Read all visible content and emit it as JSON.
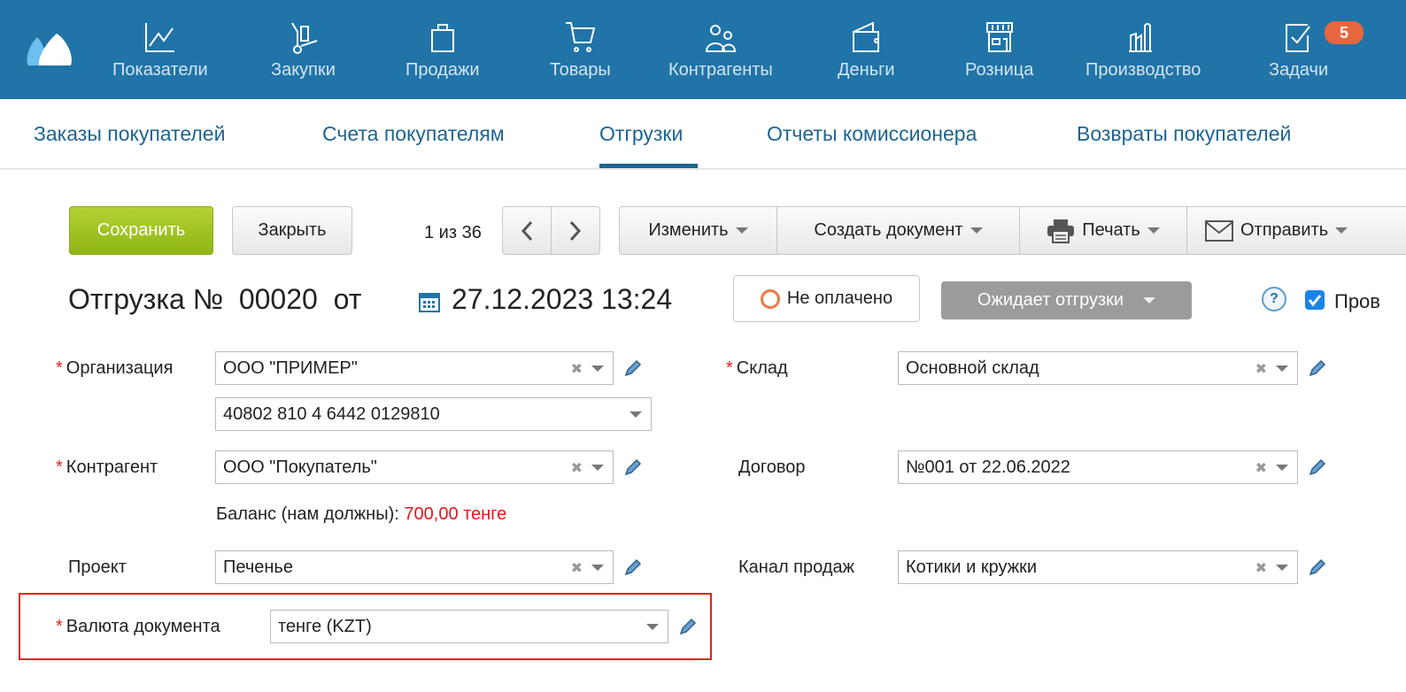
{
  "topnav": {
    "items": [
      {
        "label": "Показатели",
        "icon": "chart-line-icon"
      },
      {
        "label": "Закупки",
        "icon": "hand-truck-icon"
      },
      {
        "label": "Продажи",
        "icon": "shopping-bag-icon"
      },
      {
        "label": "Товары",
        "icon": "cart-icon"
      },
      {
        "label": "Контрагенты",
        "icon": "people-icon"
      },
      {
        "label": "Деньги",
        "icon": "wallet-icon"
      },
      {
        "label": "Розница",
        "icon": "store-icon"
      },
      {
        "label": "Производство",
        "icon": "factory-icon"
      },
      {
        "label": "Задачи",
        "icon": "task-check-icon",
        "badge": "5"
      }
    ],
    "color": "#2074a8"
  },
  "subnav": {
    "tabs": [
      {
        "label": "Заказы покупателей"
      },
      {
        "label": "Счета покупателям"
      },
      {
        "label": "Отгрузки",
        "active": true
      },
      {
        "label": "Отчеты комиссионера"
      },
      {
        "label": "Возвраты покупателей"
      }
    ]
  },
  "toolbar": {
    "save": "Сохранить",
    "close": "Закрыть",
    "pager": "1 из 36",
    "edit": "Изменить",
    "create_doc": "Создать документ",
    "print": "Печать",
    "send": "Отправить"
  },
  "doc": {
    "title": "Отгрузка №",
    "number": "00020",
    "from": "от",
    "datetime": "27.12.2023 13:24",
    "payment_status": "Не оплачено",
    "state": "Ожидает отгрузки",
    "posted_label": "Пров",
    "posted": true
  },
  "form": {
    "org_label": "Организация",
    "org_value": "ООО \"ПРИМЕР\"",
    "account_value": "40802 810 4 6442 0129810",
    "counterparty_label": "Контрагент",
    "counterparty_value": "ООО \"Покупатель\"",
    "balance_label": "Баланс (нам должны):",
    "balance_value": "700,00 тенге",
    "project_label": "Проект",
    "project_value": "Печенье",
    "currency_label": "Валюта документа",
    "currency_value": "тенге (KZT)",
    "warehouse_label": "Склад",
    "warehouse_value": "Основной склад",
    "contract_label": "Договор",
    "contract_value": "№001 от 22.06.2022",
    "channel_label": "Канал продаж",
    "channel_value": "Котики и кружки"
  }
}
